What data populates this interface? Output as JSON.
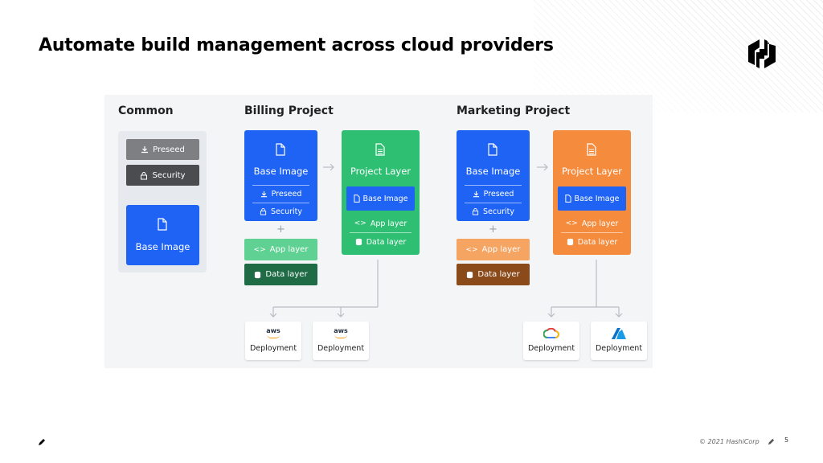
{
  "slide": {
    "title": "Automate build management across cloud providers",
    "copyright": "© 2021 HashiCorp",
    "page_number": "5"
  },
  "colors": {
    "blue": "#1f63f5",
    "green": "#2fbf73",
    "green_light": "#5fd192",
    "green_dark": "#1e6b45",
    "orange": "#f58b3c",
    "orange_light": "#f6a462",
    "brown": "#8a4a1a",
    "gray": "#7d7f83",
    "gray_dark": "#4a4c50",
    "panel": "#e6e9ed",
    "diagram_bg": "#f3f5f7"
  },
  "diagram": {
    "common": {
      "title": "Common",
      "preseed": "Preseed",
      "security": "Security",
      "base_image": "Base Image"
    },
    "billing": {
      "title": "Billing Project",
      "base_image": "Base Image",
      "preseed": "Preseed",
      "security": "Security",
      "plus": "+",
      "app_layer": "App layer",
      "data_layer": "Data layer",
      "project_layer": "Project Layer",
      "inner_base_image": "Base Image",
      "inner_app_layer": "App layer",
      "inner_data_layer": "Data layer",
      "deploy1_provider": "aws",
      "deploy1_label": "Deployment",
      "deploy2_provider": "aws",
      "deploy2_label": "Deployment"
    },
    "marketing": {
      "title": "Marketing  Project",
      "base_image": "Base Image",
      "preseed": "Preseed",
      "security": "Security",
      "plus": "+",
      "app_layer": "App layer",
      "data_layer": "Data layer",
      "project_layer": "Project Layer",
      "inner_base_image": "Base Image",
      "inner_app_layer": "App layer",
      "inner_data_layer": "Data layer",
      "deploy1_label": "Deployment",
      "deploy2_label": "Deployment"
    }
  }
}
